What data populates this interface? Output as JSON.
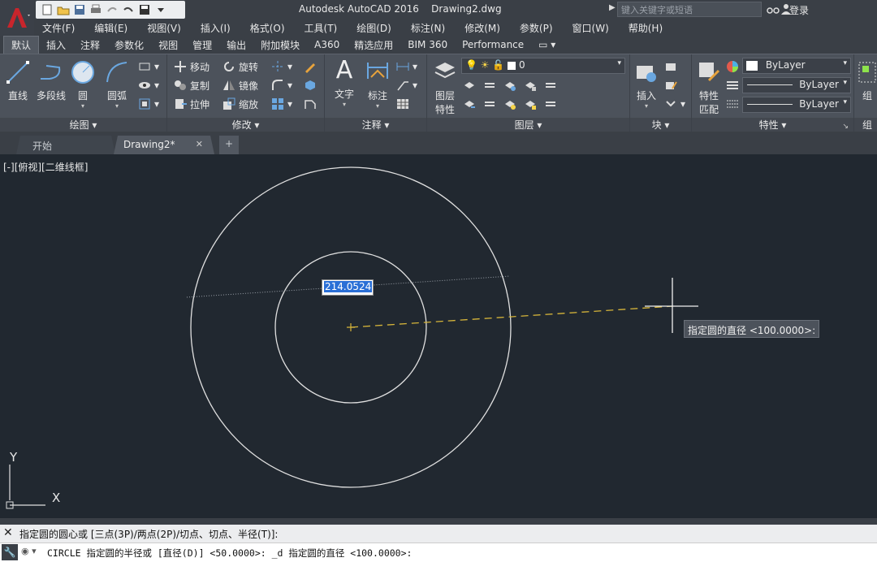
{
  "title": "Autodesk AutoCAD 2016    Drawing2.dwg",
  "search": {
    "placeholder": "键入关键字或短语"
  },
  "login": "登录",
  "menu": [
    "文件(F)",
    "编辑(E)",
    "视图(V)",
    "插入(I)",
    "格式(O)",
    "工具(T)",
    "绘图(D)",
    "标注(N)",
    "修改(M)",
    "参数(P)",
    "窗口(W)",
    "帮助(H)"
  ],
  "ribbon_tabs": [
    "默认",
    "插入",
    "注释",
    "参数化",
    "视图",
    "管理",
    "输出",
    "附加模块",
    "A360",
    "精选应用",
    "BIM 360",
    "Performance"
  ],
  "ribbon": {
    "draw": {
      "title": "绘图 ▾",
      "line": "直线",
      "polyline": "多段线",
      "circle": "圆",
      "arc": "圆弧"
    },
    "modify": {
      "title": "修改 ▾",
      "move": "移动",
      "rotate": "旋转",
      "copy": "复制",
      "mirror": "镜像",
      "stretch": "拉伸",
      "scale": "缩放"
    },
    "annotation": {
      "title": "注释 ▾",
      "text": "文字",
      "dimension": "标注"
    },
    "layers": {
      "title": "图层 ▾",
      "layer_props_1": "图层",
      "layer_props_2": "特性",
      "current_layer": "0"
    },
    "block": {
      "title": "块 ▾",
      "insert": "插入"
    },
    "properties": {
      "title": "特性 ▾",
      "match_1": "特性",
      "match_2": "匹配",
      "color": "ByLayer",
      "linetype": "ByLayer",
      "lineweight": "ByLayer"
    },
    "groups": {
      "label": "组"
    }
  },
  "doc_tabs": [
    "开始",
    "Drawing2*",
    "+"
  ],
  "viewport_label": "[-][俯视][二维线框]",
  "dynamic_input": "214.0524",
  "tooltip": "指定圆的直径 <100.0000>:",
  "ucs": {
    "y": "Y",
    "x": "X"
  },
  "command_history": "指定圆的圆心或 [三点(3P)/两点(2P)/切点、切点、半径(T)]:",
  "command_line": "CIRCLE 指定圆的半径或 [直径(D)] <50.0000>: _d 指定圆的直径 <100.0000>:",
  "colors": {
    "canvas": "#212830",
    "ribbon": "#4c525b",
    "dash": "#d6b53a",
    "highlight": "#2a6fd6",
    "app_red": "#c8252c"
  }
}
